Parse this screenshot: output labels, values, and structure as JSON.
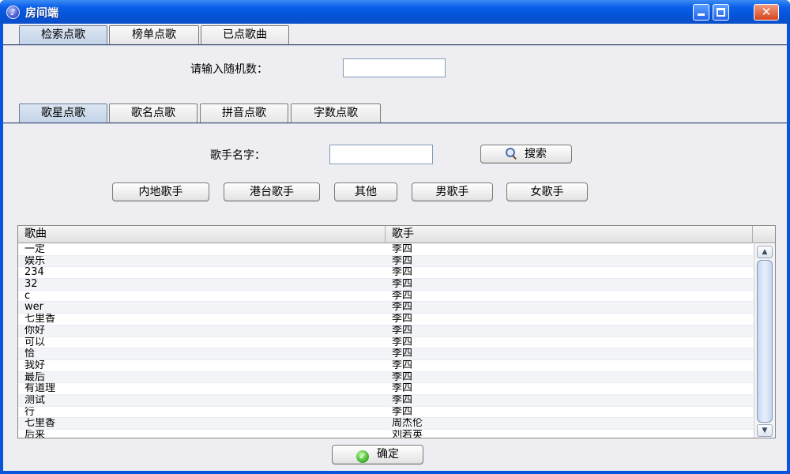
{
  "window": {
    "title": "房间端",
    "icon": "music-note-icon"
  },
  "main_tabs": [
    "检索点歌",
    "榜单点歌",
    "已点歌曲"
  ],
  "random_prompt": {
    "label": "请输入随机数：",
    "value": ""
  },
  "sub_tabs": [
    "歌星点歌",
    "歌名点歌",
    "拼音点歌",
    "字数点歌"
  ],
  "singer_search": {
    "label": "歌手名字：",
    "value": "",
    "button": "搜索"
  },
  "categories": [
    "内地歌手",
    "港台歌手",
    "其他",
    "男歌手",
    "女歌手"
  ],
  "table": {
    "columns": [
      "歌曲",
      "歌手"
    ],
    "rows": [
      [
        "一定",
        "李四"
      ],
      [
        "娱乐",
        "李四"
      ],
      [
        "234",
        "李四"
      ],
      [
        "32",
        "李四"
      ],
      [
        "c",
        "李四"
      ],
      [
        "wer",
        "李四"
      ],
      [
        "七里香",
        "李四"
      ],
      [
        "你好",
        "李四"
      ],
      [
        "可以",
        "李四"
      ],
      [
        "恰",
        "李四"
      ],
      [
        "我好",
        "李四"
      ],
      [
        "最后",
        "李四"
      ],
      [
        "有道理",
        "李四"
      ],
      [
        "测试",
        "李四"
      ],
      [
        "行",
        "李四"
      ],
      [
        "七里香",
        "周杰伦"
      ],
      [
        "后来",
        "刘若英"
      ]
    ]
  },
  "confirm_button": "确定"
}
